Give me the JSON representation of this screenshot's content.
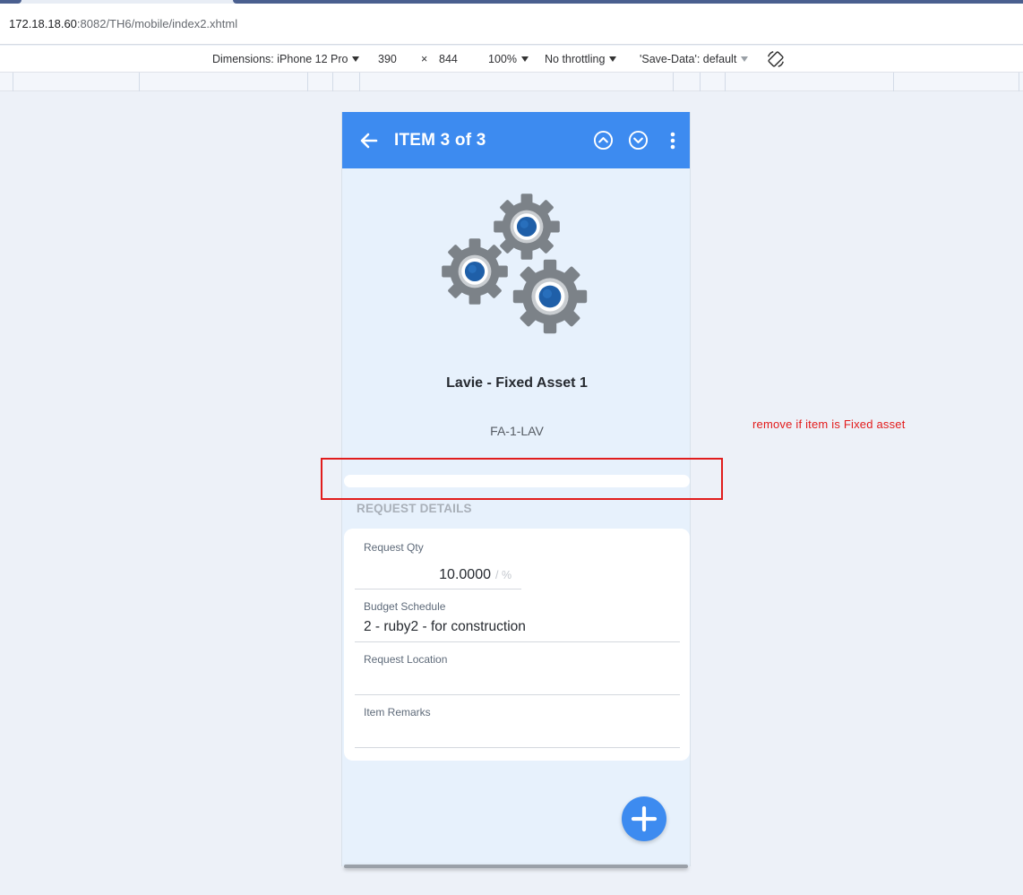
{
  "browser": {
    "url_host": "172.18.18.60",
    "url_rest": ":8082/TH6/mobile/index2.xhtml"
  },
  "devtools": {
    "dimensions_label": "Dimensions: iPhone 12 Pro",
    "width": "390",
    "times": "×",
    "height": "844",
    "zoom": "100%",
    "throttling": "No throttling",
    "save_data": "'Save-Data': default"
  },
  "app": {
    "title": "ITEM 3 of 3",
    "item_name": "Lavie - Fixed Asset 1",
    "item_code": "FA-1-LAV",
    "section_title": "REQUEST DETAILS",
    "fields": {
      "request_qty_label": "Request Qty",
      "request_qty_value": "10.0000",
      "request_qty_unit": "/ %",
      "budget_schedule_label": "Budget Schedule",
      "budget_schedule_value": "2 - ruby2 - for construction",
      "request_location_label": "Request Location",
      "request_location_value": "",
      "item_remarks_label": "Item Remarks",
      "item_remarks_value": ""
    },
    "colors": {
      "primary": "#3d8bf0",
      "screen_background": "#e7f1fc",
      "gear_grey": "#7c8288",
      "gear_center": "#1f5fa8"
    }
  },
  "annotation": {
    "text": "remove if item is Fixed asset",
    "color": "#e31b1b"
  }
}
